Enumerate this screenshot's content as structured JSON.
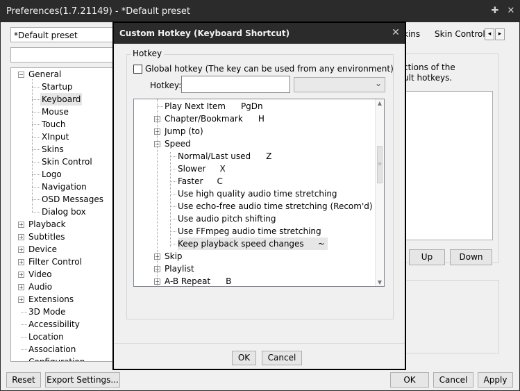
{
  "main": {
    "title": "Preferences(1.7.21149) - *Default preset",
    "preset": "*Default preset",
    "tabs": [
      "kins",
      "Skin Control"
    ],
    "tab_left_arrow": "◂",
    "tab_right_arrow": "▸",
    "description": [
      "ctions of the",
      "ult hotkeys."
    ],
    "buttons": {
      "up": "Up",
      "down": "Down",
      "reset": "Reset",
      "export": "Export Settings...",
      "ok": "OK",
      "cancel": "Cancel",
      "apply": "Apply"
    },
    "icons": {
      "pin": "pin-icon",
      "close": "close-icon"
    }
  },
  "tree": {
    "general": "General",
    "general_children": [
      "Startup",
      "Keyboard",
      "Mouse",
      "Touch",
      "XInput",
      "Skins",
      "Skin Control",
      "Logo",
      "Navigation",
      "OSD Messages",
      "Dialog box"
    ],
    "selected": "Keyboard",
    "top_items": [
      "Playback",
      "Subtitles",
      "Device",
      "Filter Control",
      "Video",
      "Audio",
      "Extensions",
      "3D Mode",
      "Accessibility",
      "Location",
      "Association",
      "Configuration"
    ]
  },
  "dialog": {
    "title": "Custom Hotkey (Keyboard Shortcut)",
    "group_label": "Hotkey",
    "global_label": "Global hotkey (The key can be used from any environment)",
    "global_checked": false,
    "hotkey_label": "Hotkey:",
    "hotkey_value": "",
    "select_value": "",
    "ok": "OK",
    "cancel": "Cancel",
    "commands": [
      {
        "label": "Play Next Item",
        "key": "PgDn",
        "level": 0,
        "expander": "none"
      },
      {
        "label": "Chapter/Bookmark",
        "key": "H",
        "level": 0,
        "expander": "plus"
      },
      {
        "label": "Jump (to)",
        "key": "",
        "level": 0,
        "expander": "plus"
      },
      {
        "label": "Speed",
        "key": "",
        "level": 0,
        "expander": "minus"
      },
      {
        "label": "Normal/Last used",
        "key": "Z",
        "level": 1,
        "expander": "none"
      },
      {
        "label": "Slower",
        "key": "X",
        "level": 1,
        "expander": "none"
      },
      {
        "label": "Faster",
        "key": "C",
        "level": 1,
        "expander": "none"
      },
      {
        "label": "Use high quality audio time stretching",
        "key": "",
        "level": 1,
        "expander": "none"
      },
      {
        "label": "Use echo-free audio time stretching (Recom'd)",
        "key": "",
        "level": 1,
        "expander": "none"
      },
      {
        "label": "Use audio pitch shifting",
        "key": "",
        "level": 1,
        "expander": "none"
      },
      {
        "label": "Use FFmpeg audio time stretching",
        "key": "",
        "level": 1,
        "expander": "none"
      },
      {
        "label": "Keep playback speed changes",
        "key": "~",
        "level": 1,
        "expander": "none",
        "highlight": true
      },
      {
        "label": "Skip",
        "key": "",
        "level": 0,
        "expander": "plus"
      },
      {
        "label": "Playlist",
        "key": "",
        "level": 0,
        "expander": "plus"
      },
      {
        "label": "A-B Repeat",
        "key": "B",
        "level": 0,
        "expander": "plus"
      }
    ]
  }
}
